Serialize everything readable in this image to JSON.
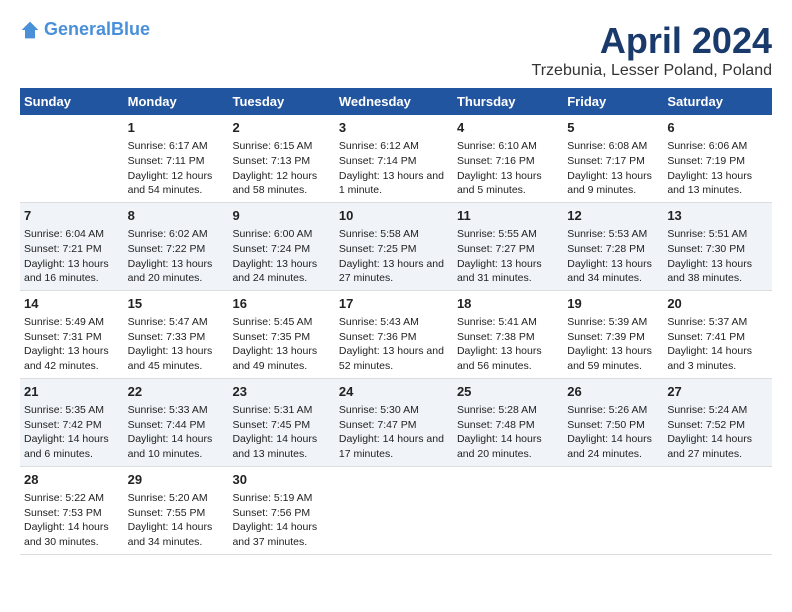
{
  "header": {
    "logo_line1": "General",
    "logo_line2": "Blue",
    "title": "April 2024",
    "subtitle": "Trzebunia, Lesser Poland, Poland"
  },
  "days_of_week": [
    "Sunday",
    "Monday",
    "Tuesday",
    "Wednesday",
    "Thursday",
    "Friday",
    "Saturday"
  ],
  "weeks": [
    [
      {
        "day": "",
        "sunrise": "",
        "sunset": "",
        "daylight": ""
      },
      {
        "day": "1",
        "sunrise": "Sunrise: 6:17 AM",
        "sunset": "Sunset: 7:11 PM",
        "daylight": "Daylight: 12 hours and 54 minutes."
      },
      {
        "day": "2",
        "sunrise": "Sunrise: 6:15 AM",
        "sunset": "Sunset: 7:13 PM",
        "daylight": "Daylight: 12 hours and 58 minutes."
      },
      {
        "day": "3",
        "sunrise": "Sunrise: 6:12 AM",
        "sunset": "Sunset: 7:14 PM",
        "daylight": "Daylight: 13 hours and 1 minute."
      },
      {
        "day": "4",
        "sunrise": "Sunrise: 6:10 AM",
        "sunset": "Sunset: 7:16 PM",
        "daylight": "Daylight: 13 hours and 5 minutes."
      },
      {
        "day": "5",
        "sunrise": "Sunrise: 6:08 AM",
        "sunset": "Sunset: 7:17 PM",
        "daylight": "Daylight: 13 hours and 9 minutes."
      },
      {
        "day": "6",
        "sunrise": "Sunrise: 6:06 AM",
        "sunset": "Sunset: 7:19 PM",
        "daylight": "Daylight: 13 hours and 13 minutes."
      }
    ],
    [
      {
        "day": "7",
        "sunrise": "Sunrise: 6:04 AM",
        "sunset": "Sunset: 7:21 PM",
        "daylight": "Daylight: 13 hours and 16 minutes."
      },
      {
        "day": "8",
        "sunrise": "Sunrise: 6:02 AM",
        "sunset": "Sunset: 7:22 PM",
        "daylight": "Daylight: 13 hours and 20 minutes."
      },
      {
        "day": "9",
        "sunrise": "Sunrise: 6:00 AM",
        "sunset": "Sunset: 7:24 PM",
        "daylight": "Daylight: 13 hours and 24 minutes."
      },
      {
        "day": "10",
        "sunrise": "Sunrise: 5:58 AM",
        "sunset": "Sunset: 7:25 PM",
        "daylight": "Daylight: 13 hours and 27 minutes."
      },
      {
        "day": "11",
        "sunrise": "Sunrise: 5:55 AM",
        "sunset": "Sunset: 7:27 PM",
        "daylight": "Daylight: 13 hours and 31 minutes."
      },
      {
        "day": "12",
        "sunrise": "Sunrise: 5:53 AM",
        "sunset": "Sunset: 7:28 PM",
        "daylight": "Daylight: 13 hours and 34 minutes."
      },
      {
        "day": "13",
        "sunrise": "Sunrise: 5:51 AM",
        "sunset": "Sunset: 7:30 PM",
        "daylight": "Daylight: 13 hours and 38 minutes."
      }
    ],
    [
      {
        "day": "14",
        "sunrise": "Sunrise: 5:49 AM",
        "sunset": "Sunset: 7:31 PM",
        "daylight": "Daylight: 13 hours and 42 minutes."
      },
      {
        "day": "15",
        "sunrise": "Sunrise: 5:47 AM",
        "sunset": "Sunset: 7:33 PM",
        "daylight": "Daylight: 13 hours and 45 minutes."
      },
      {
        "day": "16",
        "sunrise": "Sunrise: 5:45 AM",
        "sunset": "Sunset: 7:35 PM",
        "daylight": "Daylight: 13 hours and 49 minutes."
      },
      {
        "day": "17",
        "sunrise": "Sunrise: 5:43 AM",
        "sunset": "Sunset: 7:36 PM",
        "daylight": "Daylight: 13 hours and 52 minutes."
      },
      {
        "day": "18",
        "sunrise": "Sunrise: 5:41 AM",
        "sunset": "Sunset: 7:38 PM",
        "daylight": "Daylight: 13 hours and 56 minutes."
      },
      {
        "day": "19",
        "sunrise": "Sunrise: 5:39 AM",
        "sunset": "Sunset: 7:39 PM",
        "daylight": "Daylight: 13 hours and 59 minutes."
      },
      {
        "day": "20",
        "sunrise": "Sunrise: 5:37 AM",
        "sunset": "Sunset: 7:41 PM",
        "daylight": "Daylight: 14 hours and 3 minutes."
      }
    ],
    [
      {
        "day": "21",
        "sunrise": "Sunrise: 5:35 AM",
        "sunset": "Sunset: 7:42 PM",
        "daylight": "Daylight: 14 hours and 6 minutes."
      },
      {
        "day": "22",
        "sunrise": "Sunrise: 5:33 AM",
        "sunset": "Sunset: 7:44 PM",
        "daylight": "Daylight: 14 hours and 10 minutes."
      },
      {
        "day": "23",
        "sunrise": "Sunrise: 5:31 AM",
        "sunset": "Sunset: 7:45 PM",
        "daylight": "Daylight: 14 hours and 13 minutes."
      },
      {
        "day": "24",
        "sunrise": "Sunrise: 5:30 AM",
        "sunset": "Sunset: 7:47 PM",
        "daylight": "Daylight: 14 hours and 17 minutes."
      },
      {
        "day": "25",
        "sunrise": "Sunrise: 5:28 AM",
        "sunset": "Sunset: 7:48 PM",
        "daylight": "Daylight: 14 hours and 20 minutes."
      },
      {
        "day": "26",
        "sunrise": "Sunrise: 5:26 AM",
        "sunset": "Sunset: 7:50 PM",
        "daylight": "Daylight: 14 hours and 24 minutes."
      },
      {
        "day": "27",
        "sunrise": "Sunrise: 5:24 AM",
        "sunset": "Sunset: 7:52 PM",
        "daylight": "Daylight: 14 hours and 27 minutes."
      }
    ],
    [
      {
        "day": "28",
        "sunrise": "Sunrise: 5:22 AM",
        "sunset": "Sunset: 7:53 PM",
        "daylight": "Daylight: 14 hours and 30 minutes."
      },
      {
        "day": "29",
        "sunrise": "Sunrise: 5:20 AM",
        "sunset": "Sunset: 7:55 PM",
        "daylight": "Daylight: 14 hours and 34 minutes."
      },
      {
        "day": "30",
        "sunrise": "Sunrise: 5:19 AM",
        "sunset": "Sunset: 7:56 PM",
        "daylight": "Daylight: 14 hours and 37 minutes."
      },
      {
        "day": "",
        "sunrise": "",
        "sunset": "",
        "daylight": ""
      },
      {
        "day": "",
        "sunrise": "",
        "sunset": "",
        "daylight": ""
      },
      {
        "day": "",
        "sunrise": "",
        "sunset": "",
        "daylight": ""
      },
      {
        "day": "",
        "sunrise": "",
        "sunset": "",
        "daylight": ""
      }
    ]
  ]
}
